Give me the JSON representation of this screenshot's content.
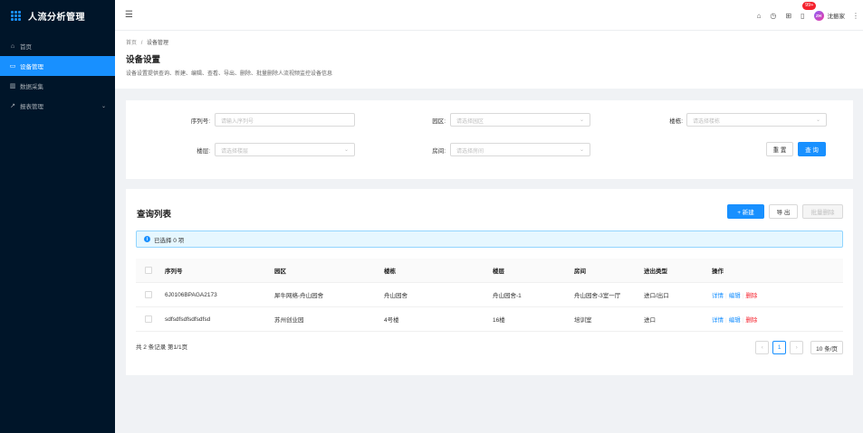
{
  "app": {
    "title": "人流分析管理"
  },
  "sidebar": {
    "items": [
      {
        "label": "首页",
        "icon": "home-icon",
        "glyph": "⌂"
      },
      {
        "label": "设备管理",
        "icon": "device-icon",
        "glyph": "▭",
        "active": true
      },
      {
        "label": "数据采集",
        "icon": "bar-chart-icon",
        "glyph": "▥"
      },
      {
        "label": "报表管理",
        "icon": "line-chart-icon",
        "glyph": "↗",
        "has_children": true
      }
    ]
  },
  "header": {
    "notification_badge": "99+",
    "username": "沈振家",
    "avatar_text": "ZH"
  },
  "breadcrumb": {
    "home": "首页",
    "separator": "/",
    "current": "设备管理"
  },
  "page": {
    "title": "设备设置",
    "description": "设备设置提供查询、新建、编辑、查看、导出、删除、批量删除人流视频监控设备信息"
  },
  "filters": {
    "serial": {
      "label": "序列号:",
      "placeholder": "请输入序列号"
    },
    "park": {
      "label": "园区:",
      "placeholder": "请选择园区"
    },
    "building": {
      "label": "楼栋:",
      "placeholder": "请选择楼栋"
    },
    "floor": {
      "label": "楼层:",
      "placeholder": "请选择楼层"
    },
    "room": {
      "label": "房间:",
      "placeholder": "请选择房间"
    },
    "reset_label": "重 置",
    "query_label": "查 询"
  },
  "list": {
    "title": "查询列表",
    "new_label": "+ 新建",
    "export_label": "导 出",
    "batch_delete_label": "批量删除",
    "selected_text": "已选择 0 项",
    "columns": [
      "序列号",
      "园区",
      "楼栋",
      "楼层",
      "房间",
      "进出类型",
      "操作"
    ],
    "rows": [
      [
        "6J0106BPAGA2173",
        "犀牛网络-舟山园舍",
        "舟山园舍",
        "舟山园舍-1",
        "舟山园舍-3室一厅",
        "进口/出口"
      ],
      [
        "sdfsdfsdfsdfsdfsd",
        "苏州创业园",
        "4号楼",
        "16楼",
        "培训室",
        "进口"
      ]
    ],
    "actions": {
      "detail": "详情",
      "edit": "编辑",
      "delete": "删除"
    },
    "total_text": "共 2 条记录 第1/1页",
    "current_page": "1",
    "page_size": "10 条/页"
  }
}
